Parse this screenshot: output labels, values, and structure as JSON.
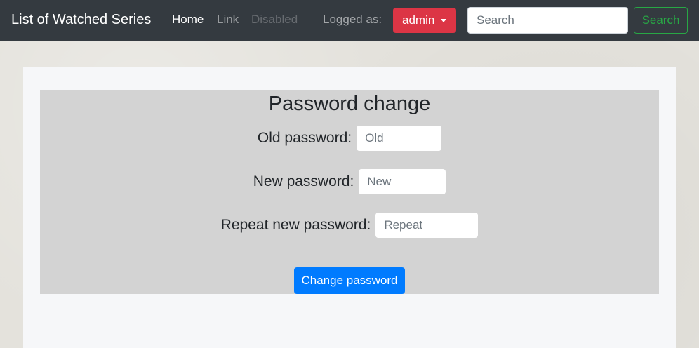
{
  "navbar": {
    "brand": "List of Watched Series",
    "links": [
      {
        "label": "Home",
        "state": "active"
      },
      {
        "label": "Link",
        "state": "normal"
      },
      {
        "label": "Disabled",
        "state": "disabled"
      }
    ],
    "logged_label": "Logged as:",
    "user_button": {
      "label": "admin",
      "color": "#dc3545"
    },
    "search": {
      "placeholder": "Search",
      "value": ""
    },
    "search_button": {
      "label": "Search",
      "color": "#28a745"
    },
    "background_color": "#343a40"
  },
  "form": {
    "title": "Password change",
    "fields": [
      {
        "label": "Old password:",
        "placeholder": "Old",
        "value": ""
      },
      {
        "label": "New password:",
        "placeholder": "New",
        "value": ""
      },
      {
        "label": "Repeat new password:",
        "placeholder": "Repeat",
        "value": ""
      }
    ],
    "submit_label": "Change password",
    "submit_color": "#007bff",
    "panel_color": "#d3d3d3"
  }
}
